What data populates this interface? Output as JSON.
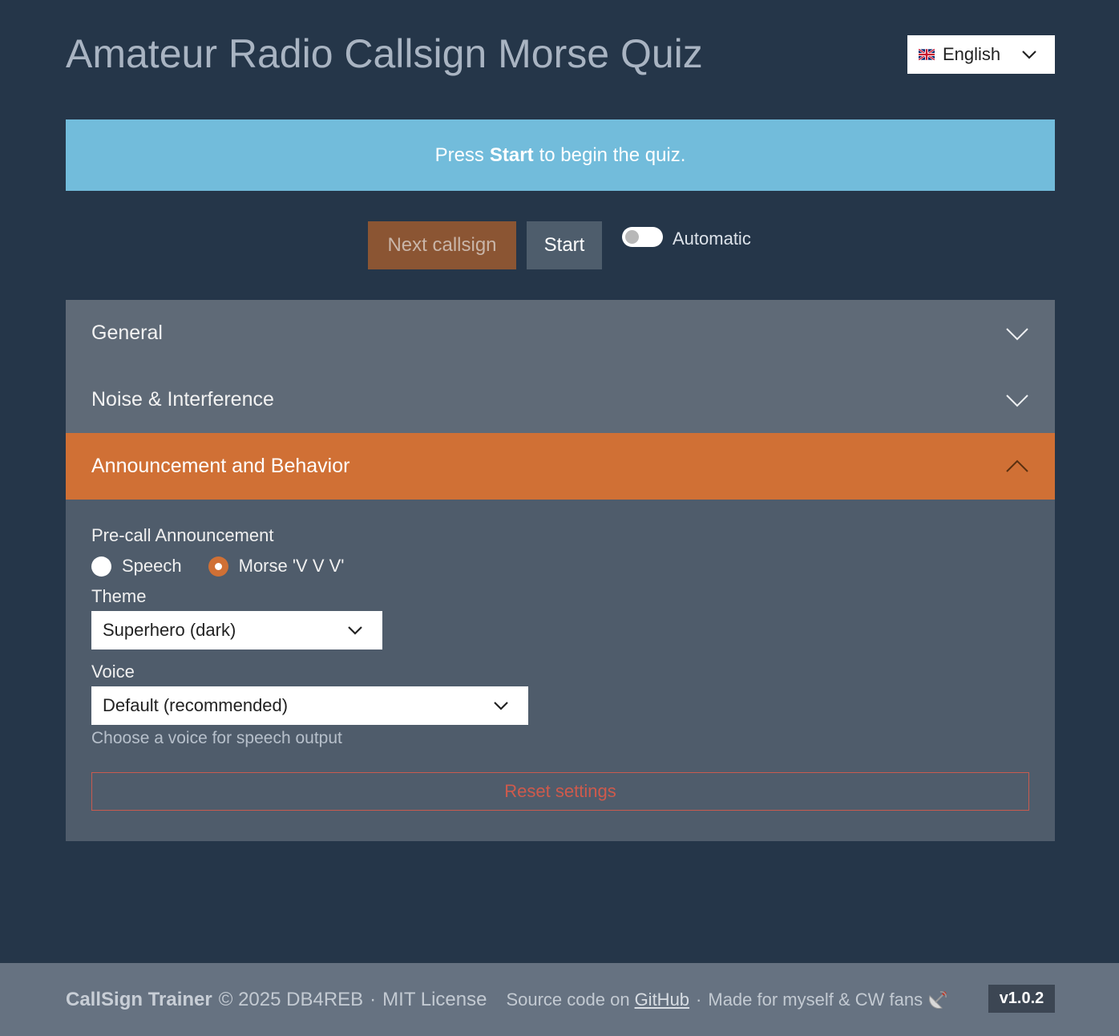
{
  "header": {
    "title": "Amateur Radio Callsign Morse Quiz",
    "language": {
      "selected": "English",
      "flag_icon": "uk-flag-icon"
    }
  },
  "banner": {
    "prefix": "Press",
    "bold": "Start",
    "suffix": "to begin the quiz."
  },
  "controls": {
    "next_label": "Next callsign",
    "start_label": "Start",
    "automatic_label": "Automatic",
    "automatic_on": false
  },
  "accordion": {
    "sections": [
      {
        "label": "General",
        "expanded": false
      },
      {
        "label": "Noise & Interference",
        "expanded": false
      },
      {
        "label": "Announcement and Behavior",
        "expanded": true
      }
    ]
  },
  "behavior": {
    "precall_label": "Pre-call Announcement",
    "precall_options": [
      {
        "label": "Speech",
        "checked": false
      },
      {
        "label": "Morse 'V V V'",
        "checked": true
      }
    ],
    "theme_label": "Theme",
    "theme_value": "Superhero (dark)",
    "voice_label": "Voice",
    "voice_value": "Default (recommended)",
    "voice_help": "Choose a voice for speech output",
    "reset_label": "Reset settings"
  },
  "footer": {
    "brand": "CallSign Trainer",
    "copyright": "© 2025 DB4REB",
    "license": "MIT License",
    "source_prefix": "Source code on",
    "source_link": "GitHub",
    "made_for": "Made for myself & CW fans",
    "version": "v1.0.2"
  },
  "colors": {
    "background": "#253649",
    "accent": "#d07035",
    "banner": "#72bcdb",
    "panel": "#5f6a77"
  }
}
